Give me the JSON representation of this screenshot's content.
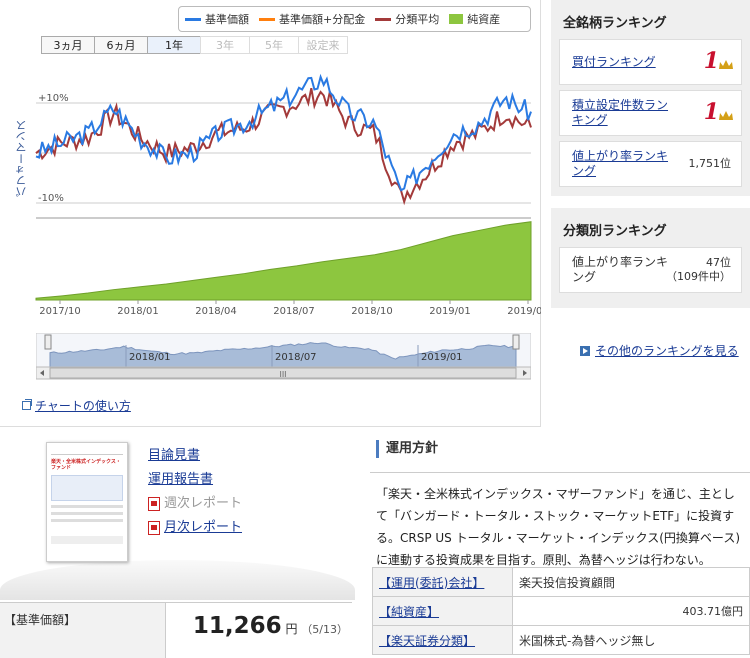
{
  "legend": {
    "items": [
      {
        "label": "基準価額",
        "color": "#2a7ae2"
      },
      {
        "label": "基準価額+分配金",
        "color": "#ff7f0e"
      },
      {
        "label": "分類平均",
        "color": "#a33a3a"
      },
      {
        "label": "純資産",
        "color": "#8dc63f"
      }
    ]
  },
  "period_tabs": [
    {
      "label": "3ヵ月",
      "enabled": true
    },
    {
      "label": "6ヵ月",
      "enabled": true
    },
    {
      "label": "1年",
      "enabled": true
    },
    {
      "label": "3年",
      "enabled": false
    },
    {
      "label": "5年",
      "enabled": false
    },
    {
      "label": "設定来",
      "enabled": false
    }
  ],
  "chart": {
    "ylabel": "パフォーマンス",
    "y_ticks": [
      "+10%",
      "-10%"
    ],
    "x_ticks": [
      "2017/10",
      "2018/01",
      "2018/04",
      "2018/07",
      "2018/10",
      "2019/01",
      "2019/04"
    ],
    "nav_ticks": [
      "2018/01",
      "2018/07",
      "2019/01"
    ],
    "scroll_handle": "III"
  },
  "chart_data": {
    "type": "line",
    "ylabel": "パフォーマンス",
    "x": [
      "2017/10",
      "2017/11",
      "2017/12",
      "2018/01",
      "2018/02",
      "2018/03",
      "2018/04",
      "2018/05",
      "2018/06",
      "2018/07",
      "2018/08",
      "2018/09",
      "2018/10",
      "2018/11",
      "2018/12",
      "2019/01",
      "2019/02",
      "2019/03",
      "2019/04",
      "2019/05"
    ],
    "series": [
      {
        "name": "基準価額",
        "values": [
          0,
          2,
          4,
          9,
          3,
          -1,
          0,
          4,
          6,
          9,
          12,
          15,
          8,
          6,
          -8,
          -2,
          4,
          6,
          11,
          8
        ]
      },
      {
        "name": "分類平均",
        "values": [
          0,
          2,
          3,
          8,
          3,
          0,
          1,
          4,
          5,
          8,
          10,
          12,
          6,
          4,
          -9,
          -4,
          2,
          4,
          8,
          5
        ]
      },
      {
        "name": "純資産",
        "values": [
          5,
          12,
          20,
          30,
          38,
          46,
          56,
          66,
          76,
          88,
          98,
          110,
          120,
          130,
          145,
          165,
          185,
          200,
          215,
          225
        ]
      }
    ]
  },
  "howto_link": "チャートの使い方",
  "sidebar": {
    "all_title": "全銘柄ランキング",
    "all_rows": [
      {
        "label": "買付ランキング",
        "value": "1",
        "type": "rank1"
      },
      {
        "label": "積立設定件数ランキング",
        "value": "1",
        "type": "rank1"
      },
      {
        "label": "値上がり率ランキング",
        "value": "1,751位",
        "type": "text"
      }
    ],
    "cat_title": "分類別ランキング",
    "cat_row": {
      "label": "値上がり率ランキング",
      "value": "47位",
      "sub": "（109件中）"
    },
    "other_link": "その他のランキングを見る"
  },
  "docs": {
    "thumb_title": "楽天・全米株式インデックス・ファンド",
    "links": [
      {
        "label": "目論見書",
        "icon": false,
        "enabled": true
      },
      {
        "label": "運用報告書",
        "icon": false,
        "enabled": true
      },
      {
        "label": "週次レポート",
        "icon": true,
        "enabled": false
      },
      {
        "label": "月次レポート",
        "icon": true,
        "enabled": true
      }
    ]
  },
  "price": {
    "label": "【基準価額】",
    "value": "11,266",
    "unit": "円",
    "date": "（5/13）"
  },
  "policy": {
    "title": "運用方針",
    "text": "「楽天・全米株式インデックス・マザーファンド」を通じ、主として「バンガード・トータル・ストック・マーケットETF」に投資する。CRSP US トータル・マーケット・インデックス(円換算ベース)に連動する投資成果を目指す。原則、為替ヘッジは行わない。",
    "rows": [
      {
        "key": "【運用(委託)会社】",
        "value": "楽天投信投資顧問"
      },
      {
        "key": "【純資産】",
        "value": "403.71億円"
      },
      {
        "key": "【楽天証券分類】",
        "value": "米国株式-為替ヘッジ無し"
      }
    ]
  }
}
